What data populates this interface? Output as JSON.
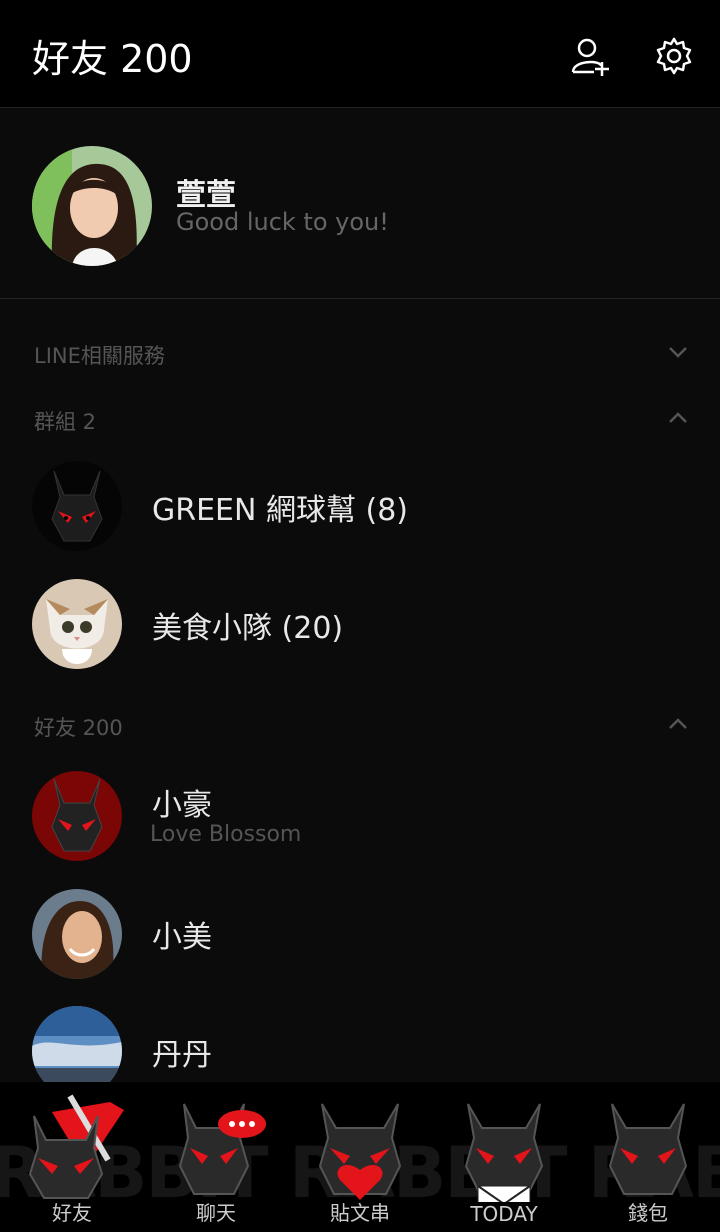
{
  "header": {
    "title": "好友 200",
    "add_friend_icon": "add-friend-icon",
    "settings_icon": "gear-icon"
  },
  "profile": {
    "name": "萱萱",
    "status": "Good luck to you!"
  },
  "sections": {
    "services": "LINE相關服務",
    "groups": "群組 2",
    "friends": "好友 200"
  },
  "groups": [
    {
      "name": "GREEN 網球幫 (8)"
    },
    {
      "name": "美食小隊 (20)"
    }
  ],
  "friends": [
    {
      "name": "小豪",
      "status": "Love Blossom"
    },
    {
      "name": "小美"
    },
    {
      "name": "丹丹"
    }
  ],
  "tabbar": {
    "bg_text": "RABBIT RABBIT RABBIT",
    "tabs": [
      {
        "label": "好友"
      },
      {
        "label": "聊天"
      },
      {
        "label": "貼文串"
      },
      {
        "label": "TODAY"
      },
      {
        "label": "錢包"
      }
    ]
  },
  "colors": {
    "accent": "#e4141b",
    "background": "#0b0b0b",
    "header": "#000000"
  }
}
